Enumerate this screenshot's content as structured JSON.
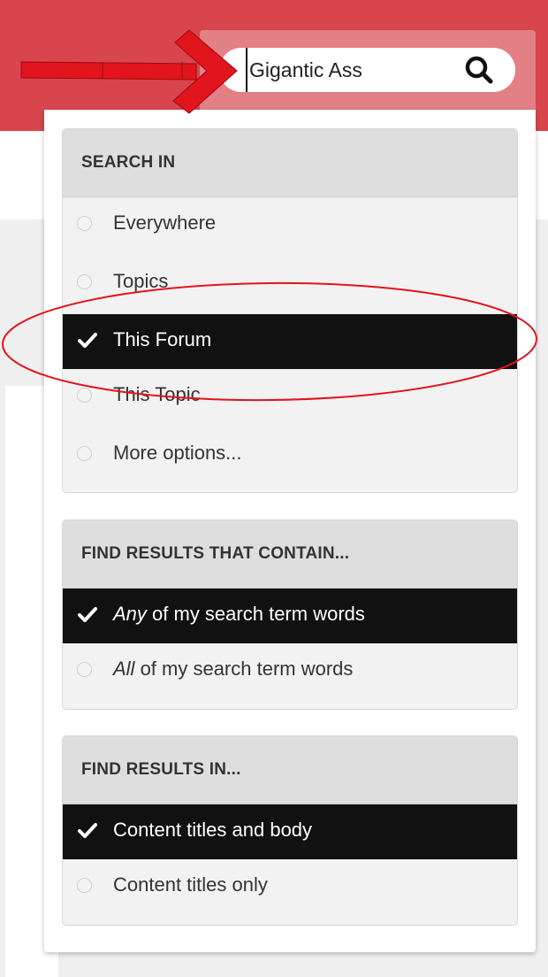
{
  "search": {
    "value": "Gigantic Ass"
  },
  "panels": [
    {
      "header": "SEARCH IN",
      "options": [
        {
          "label": "Everywhere",
          "selected": false
        },
        {
          "label": "Topics",
          "selected": false
        },
        {
          "label": "This Forum",
          "selected": true
        },
        {
          "label": "This Topic",
          "selected": false
        },
        {
          "label": "More options...",
          "selected": false
        }
      ]
    },
    {
      "header": "FIND RESULTS THAT CONTAIN...",
      "options": [
        {
          "emphasis": "Any",
          "label": " of my search term words",
          "selected": true
        },
        {
          "emphasis": "All",
          "label": " of my search term words",
          "selected": false
        }
      ]
    },
    {
      "header": "FIND RESULTS IN...",
      "options": [
        {
          "label": "Content titles and body",
          "selected": true
        },
        {
          "label": "Content titles only",
          "selected": false
        }
      ]
    }
  ],
  "colors": {
    "header_red": "#d9454c",
    "selected_bg": "#111111",
    "annotation_red": "#e2141d"
  },
  "icons": [
    "search-icon",
    "checkmark-icon",
    "radio-icon",
    "red-arrow-annotation",
    "red-ellipse-annotation"
  ]
}
